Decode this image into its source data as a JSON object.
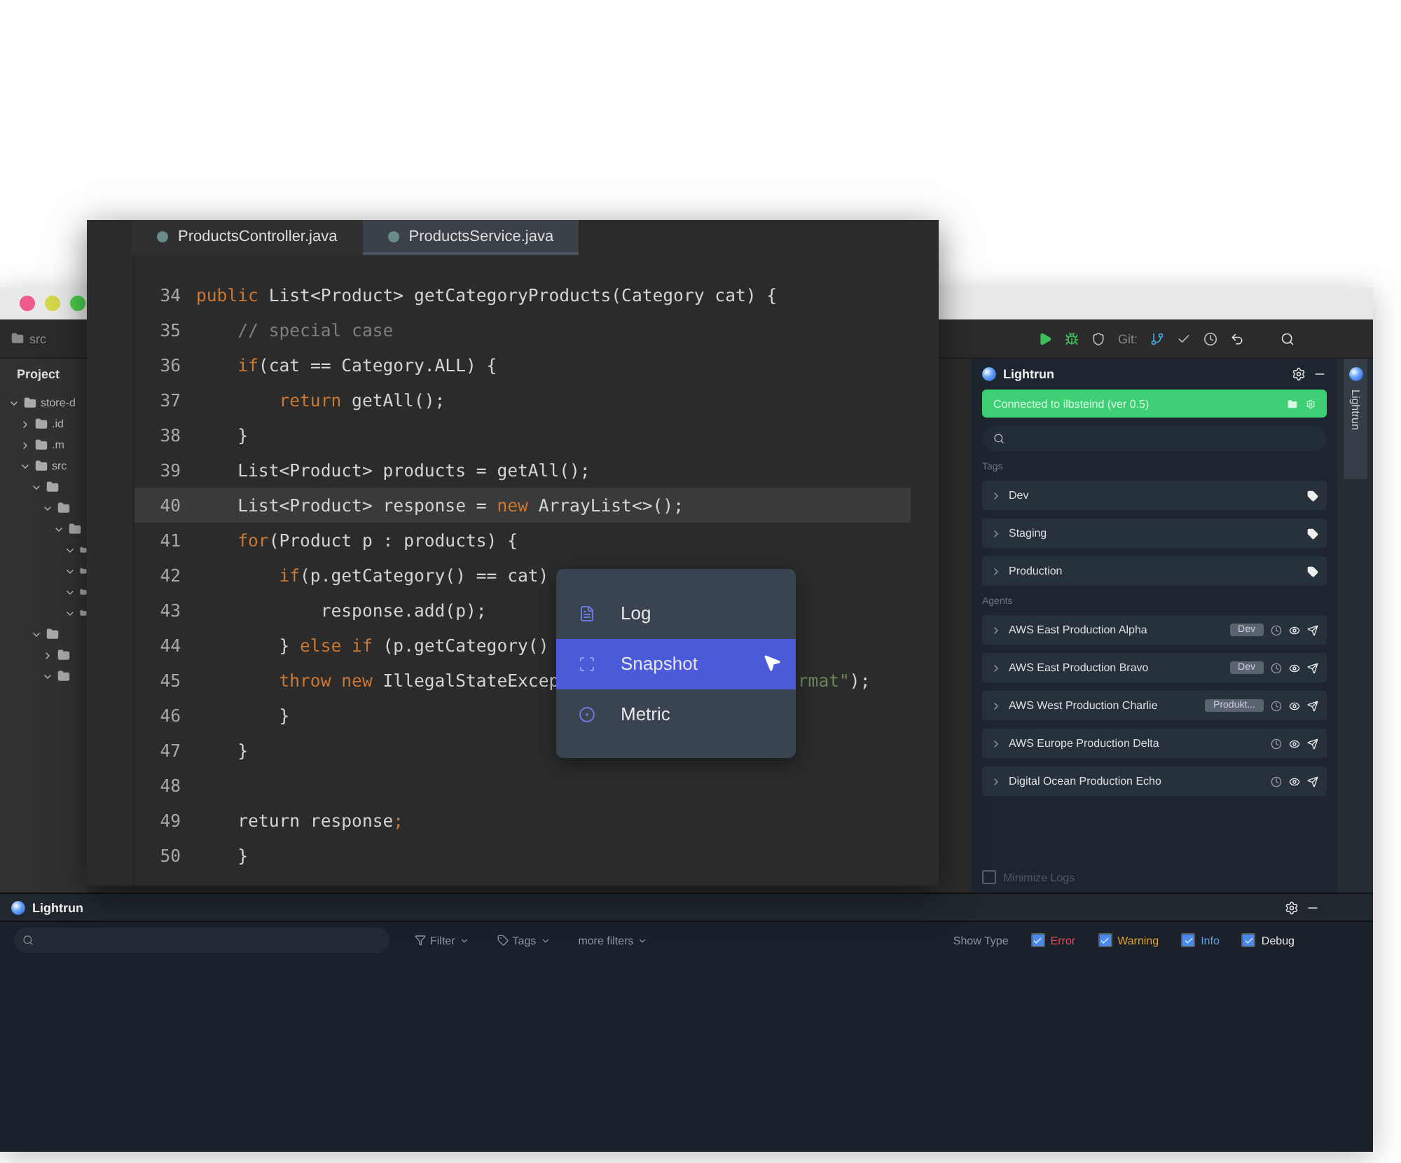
{
  "ide": {
    "breadcrumb": "src",
    "toolbar": {
      "git_label": "Git:"
    },
    "project": {
      "title": "Project",
      "tree": [
        {
          "label": "store-d",
          "expanded": true,
          "children": [
            {
              "label": ".id",
              "expanded": false
            },
            {
              "label": ".m",
              "expanded": false
            },
            {
              "label": "src",
              "expanded": true,
              "children": [
                {
                  "expanded": true,
                  "children": [
                    {
                      "expanded": true,
                      "children": [
                        {
                          "expanded": true,
                          "children": [
                            {
                              "expanded": true
                            },
                            {
                              "expanded": true
                            },
                            {
                              "expanded": true
                            },
                            {
                              "expanded": true
                            }
                          ]
                        }
                      ]
                    }
                  ]
                },
                {
                  "expanded": true,
                  "children": [
                    {
                      "expanded": false
                    },
                    {
                      "expanded": true
                    }
                  ]
                }
              ]
            }
          ]
        }
      ]
    },
    "lightrun": {
      "title": "Lightrun",
      "status": "Connected to ilbsteind (ver 0.5)",
      "tags_label": "Tags",
      "tags": [
        {
          "label": "Dev"
        },
        {
          "label": "Staging"
        },
        {
          "label": "Production"
        }
      ],
      "agents_label": "Agents",
      "agents": [
        {
          "name": "AWS East Production Alpha",
          "badge": "Dev"
        },
        {
          "name": "AWS East Production Bravo",
          "badge": "Dev"
        },
        {
          "name": "AWS West Production Charlie",
          "badge": "Produkt..."
        },
        {
          "name": "AWS Europe Production Delta"
        },
        {
          "name": "Digital Ocean Production Echo"
        }
      ],
      "minimize_logs": {
        "label": "Minimize Logs",
        "checked": false
      }
    },
    "side_tab": "Lightrun",
    "logs": {
      "title": "Lightrun",
      "filters": [
        {
          "kind": "filter",
          "label": "Filter"
        },
        {
          "kind": "tag",
          "label": "Tags"
        },
        {
          "kind": "plain",
          "label": "more filters"
        }
      ],
      "show_type_label": "Show Type",
      "types": [
        {
          "label": "Error",
          "checked": true,
          "color": "#e0475a"
        },
        {
          "label": "Warning",
          "checked": true,
          "color": "#e0a030"
        },
        {
          "label": "Info",
          "checked": true,
          "color": "#5b9de0"
        },
        {
          "label": "Debug",
          "checked": true,
          "color": "#e6e6e6"
        }
      ]
    }
  },
  "editor": {
    "tabs": [
      {
        "label": "ProductsController.java",
        "selected": false
      },
      {
        "label": "ProductsService.java",
        "selected": true
      }
    ],
    "lines": [
      {
        "number": "34",
        "selected": false,
        "tokens": [
          {
            "kind": "kw",
            "text": "public"
          },
          {
            "kind": "plain",
            "text": " List<Product> getCategoryProducts(Category cat) {"
          }
        ],
        "children": [
          {
            "number": "35",
            "selected": false,
            "tokens": [
              {
                "kind": "comment",
                "text": "// special case"
              }
            ]
          },
          {
            "number": "36",
            "selected": false,
            "tokens": [
              {
                "kind": "kw",
                "text": "if"
              },
              {
                "kind": "plain",
                "text": "(cat == Category.ALL) {"
              }
            ],
            "children": [
              {
                "number": "37",
                "selected": false,
                "tokens": [
                  {
                    "kind": "kw",
                    "text": "return"
                  },
                  {
                    "kind": "plain",
                    "text": " getAll();"
                  }
                ]
              }
            ]
          },
          {
            "number": "38",
            "selected": false,
            "tokens": [
              {
                "kind": "plain",
                "text": "}"
              }
            ]
          },
          {
            "number": "39",
            "selected": false,
            "tokens": [
              {
                "kind": "plain",
                "text": "List<Product> products = getAll();"
              }
            ]
          },
          {
            "number": "40",
            "selected": true,
            "tokens": [
              {
                "kind": "plain",
                "text": "List<Product> response = "
              },
              {
                "kind": "kw",
                "text": "new"
              },
              {
                "kind": "plain",
                "text": " ArrayList<>();"
              }
            ]
          },
          {
            "number": "41",
            "selected": false,
            "tokens": [
              {
                "kind": "kw",
                "text": "for"
              },
              {
                "kind": "plain",
                "text": "(Product p : products) {"
              }
            ],
            "children": [
              {
                "number": "42",
                "selected": false,
                "tokens": [
                  {
                    "kind": "kw",
                    "text": "if"
                  },
                  {
                    "kind": "plain",
                    "text": "(p.getCategory() == cat)"
                  }
                ],
                "children": [
                  {
                    "number": "43",
                    "selected": false,
                    "tokens": [
                      {
                        "kind": "plain",
                        "text": "response.add(p);"
                      }
                    ]
                  }
                ]
              },
              {
                "number": "44",
                "selected": false,
                "tokens": [
                  {
                    "kind": "plain",
                    "text": "} "
                  },
                  {
                    "kind": "kw",
                    "text": "else if"
                  },
                  {
                    "kind": "plain",
                    "text": " (p.getCategory()"
                  }
                ]
              },
              {
                "number": "45",
                "selected": false,
                "tokens": [
                  {
                    "kind": "kw",
                    "text": "throw new"
                  },
                  {
                    "kind": "plain",
                    "text": " IllegalStateExcep"
                  }
                ],
                "tail": [
                  {
                    "kind": "string",
                    "text": "rmat\""
                  },
                  {
                    "kind": "plain",
                    "text": ");"
                  }
                ]
              },
              {
                "number": "46",
                "selected": false,
                "tokens": [
                  {
                    "kind": "plain",
                    "text": "}"
                  }
                ]
              }
            ]
          },
          {
            "number": "47",
            "selected": false,
            "tokens": [
              {
                "kind": "plain",
                "text": "}"
              }
            ]
          },
          {
            "number": "48",
            "selected": false
          },
          {
            "number": "49",
            "selected": false,
            "tokens": [
              {
                "kind": "plain",
                "text": "return response"
              },
              {
                "kind": "kw",
                "text": ";"
              }
            ]
          },
          {
            "number": "50",
            "selected": false,
            "tokens": [
              {
                "kind": "plain",
                "text": "}"
              }
            ]
          }
        ]
      }
    ],
    "menu": [
      {
        "kind": "log",
        "label": "Log",
        "selected": false
      },
      {
        "kind": "snapshot",
        "label": "Snapshot",
        "selected": true
      },
      {
        "kind": "metric",
        "label": "Metric",
        "selected": false
      }
    ]
  }
}
